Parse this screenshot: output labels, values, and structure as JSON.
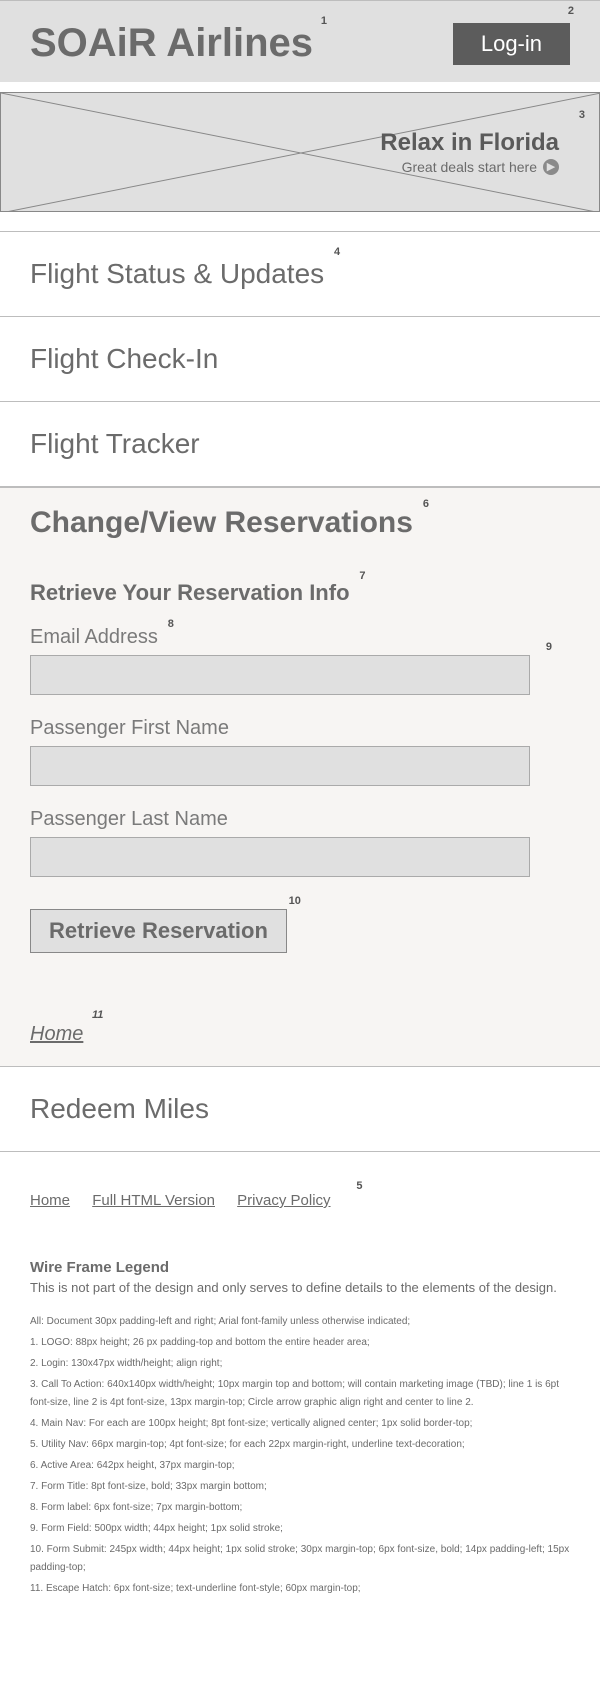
{
  "header": {
    "logo": "SOAiR Airlines",
    "login_label": "Log-in"
  },
  "cta": {
    "title": "Relax in Florida",
    "subtitle": "Great deals start here"
  },
  "nav": {
    "flight_status": "Flight Status & Updates",
    "flight_checkin": "Flight Check-In",
    "flight_tracker": "Flight Tracker"
  },
  "active": {
    "heading": "Change/View Reservations",
    "form_title": "Retrieve Your Reservation Info",
    "email_label": "Email Address",
    "first_name_label": "Passenger First Name",
    "last_name_label": "Passenger Last Name",
    "submit_label": "Retrieve Reservation",
    "escape_label": "Home"
  },
  "redeem": {
    "label": "Redeem Miles"
  },
  "util_nav": {
    "home": "Home",
    "full_html": "Full HTML Version",
    "privacy": "Privacy Policy"
  },
  "legend": {
    "title": "Wire Frame Legend",
    "subtitle": "This is not part of the design and only serves to define details to the elements of the design.",
    "items": [
      "All: Document 30px padding-left and right; Arial font-family unless otherwise indicated;",
      "1. LOGO: 88px height; 26 px padding-top and bottom the entire header area;",
      "2. Login: 130x47px width/height; align right;",
      "3. Call To Action: 640x140px width/height; 10px margin top and bottom; will contain marketing image (TBD); line 1 is 6pt font-size, line 2 is 4pt font-size, 13px margin-top; Circle arrow graphic align right and center to line 2.",
      "4. Main Nav: For each are 100px height; 8pt font-size; vertically aligned center; 1px solid border-top;",
      "5. Utility Nav: 66px margin-top; 4pt font-size; for each 22px margin-right, underline text-decoration;",
      "6. Active Area: 642px height, 37px margin-top;",
      "7. Form Title: 8pt font-size, bold; 33px margin bottom;",
      "8. Form label: 6px font-size; 7px margin-bottom;",
      "9. Form Field: 500px width; 44px height; 1px solid stroke;",
      "10. Form Submit: 245px width; 44px height; 1px solid stroke; 30px margin-top; 6px font-size, bold; 14px padding-left; 15px padding-top;",
      "11. Escape Hatch: 6px font-size; text-underline font-style; 60px margin-top;"
    ]
  }
}
